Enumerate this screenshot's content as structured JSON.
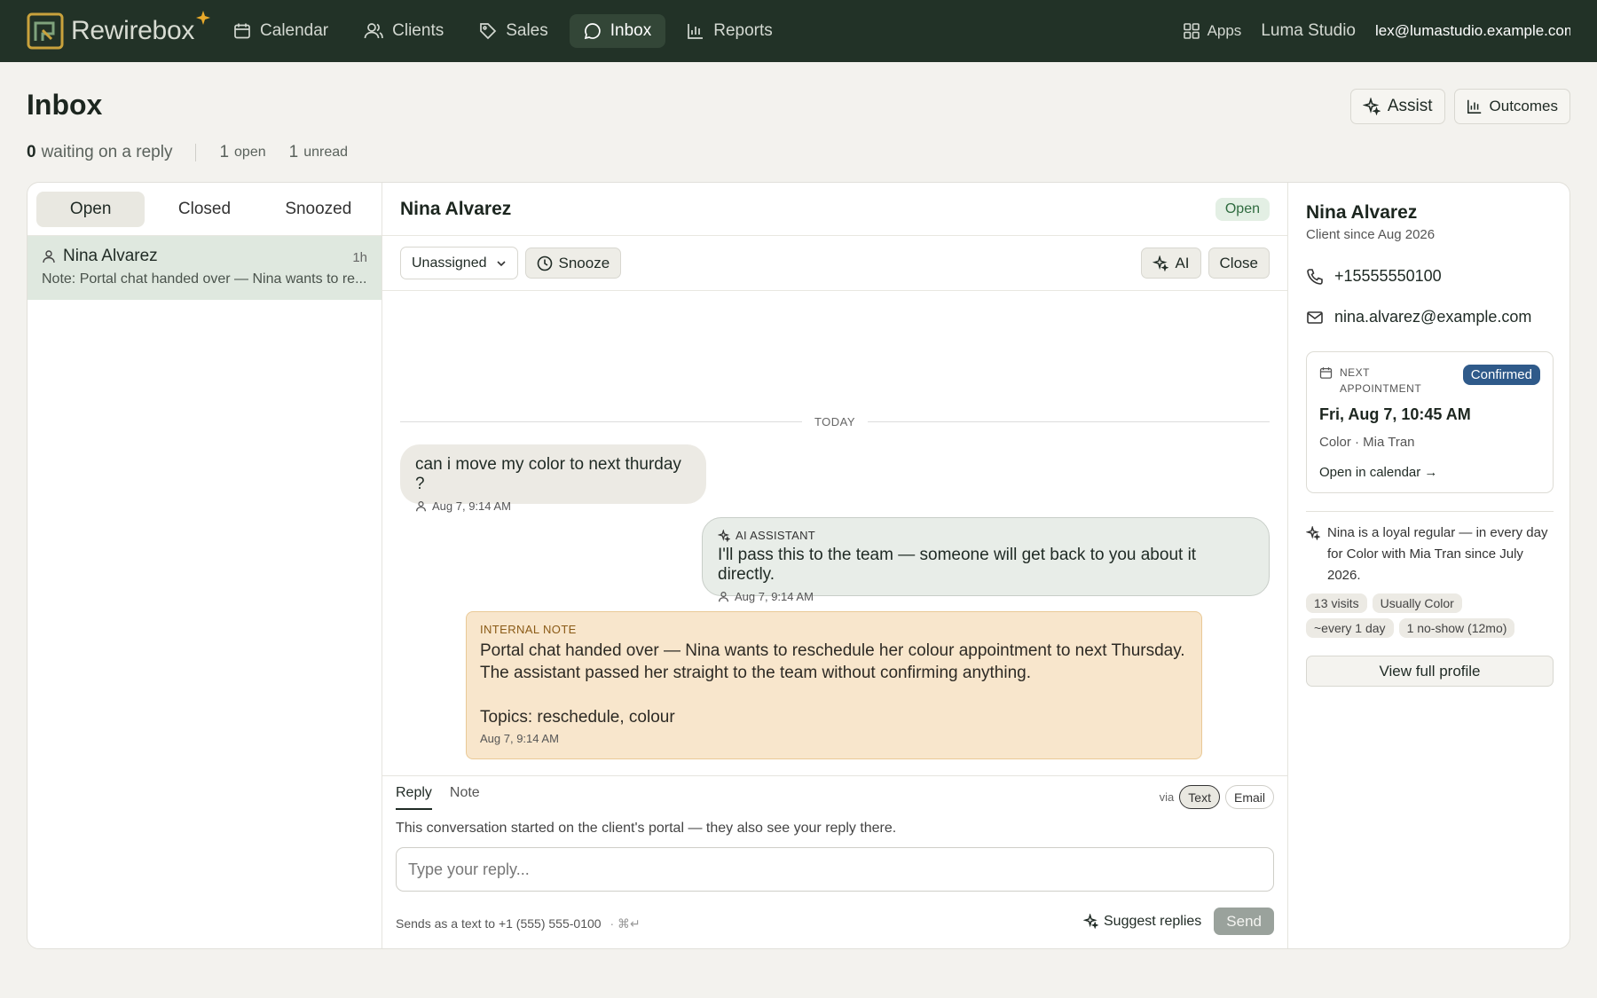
{
  "app": {
    "name": "Rewirebox"
  },
  "nav": {
    "items": [
      {
        "label": "Calendar",
        "icon": "calendar-icon"
      },
      {
        "label": "Clients",
        "icon": "users-icon"
      },
      {
        "label": "Sales",
        "icon": "tag-icon"
      },
      {
        "label": "Inbox",
        "icon": "chat-icon",
        "active": true
      },
      {
        "label": "Reports",
        "icon": "bar-chart-icon"
      }
    ],
    "apps_label": "Apps",
    "studio": "Luma Studio",
    "user_email": "lex@lumastudio.example.com"
  },
  "page": {
    "title": "Inbox",
    "assist_label": "Assist",
    "outcomes_label": "Outcomes",
    "stats": {
      "waiting_count": "0",
      "waiting_label": "waiting on a reply",
      "open_count": "1",
      "open_label": "open",
      "unread_count": "1",
      "unread_label": "unread"
    }
  },
  "list": {
    "tabs": [
      "Open",
      "Closed",
      "Snoozed"
    ],
    "active_tab": "Open",
    "conversations": [
      {
        "name": "Nina Alvarez",
        "time": "1h",
        "preview": "Note: Portal chat handed over — Nina wants to re..."
      }
    ]
  },
  "thread": {
    "name": "Nina Alvarez",
    "status": "Open",
    "assignee": "Unassigned",
    "snooze_label": "Snooze",
    "ai_label": "AI",
    "close_label": "Close",
    "day_divider": "TODAY",
    "messages": [
      {
        "text": "can i move my color to next thurday ?",
        "time": "Aug 7, 9:14 AM"
      },
      {
        "label": "AI ASSISTANT",
        "text": "I'll pass this to the team — someone will get back to you about it directly.",
        "time": "Aug 7, 9:14 AM"
      }
    ],
    "note": {
      "label": "INTERNAL NOTE",
      "text": "Portal chat handed over — Nina wants to reschedule her colour appointment to next Thursday.\nThe assistant passed her straight to the team without confirming anything.\n\nTopics: reschedule, colour",
      "time": "Aug 7, 9:14 AM"
    }
  },
  "composer": {
    "tabs": [
      "Reply",
      "Note"
    ],
    "via_label": "via",
    "channels": [
      "Text",
      "Email"
    ],
    "hint": "This conversation started on the client's portal — they also see your reply there.",
    "placeholder": "Type your reply...",
    "sends_as": "Sends as a text to +1 (555) 555-0100",
    "shortcut": "· ⌘↵",
    "suggest_label": "Suggest replies",
    "send_label": "Send"
  },
  "profile": {
    "name": "Nina Alvarez",
    "since": "Client since Aug 2026",
    "phone": "+15555550100",
    "email": "nina.alvarez@example.com",
    "appointment": {
      "label": "NEXT APPOINTMENT",
      "status": "Confirmed",
      "when": "Fri, Aug 7, 10:45 AM",
      "service": "Color · Mia Tran",
      "link": "Open in calendar →"
    },
    "summary": "Nina is a loyal regular — in every day for Color with Mia Tran since July 2026.",
    "tags": [
      "13 visits",
      "Usually Color",
      "~every 1 day",
      "1 no-show (12mo)"
    ],
    "view_profile_label": "View full profile"
  },
  "colors": {
    "topbar": "#223227",
    "accent": "#2f6b3f",
    "confirmed": "#2f5a8a",
    "note_bg": "#f8e6cc"
  }
}
